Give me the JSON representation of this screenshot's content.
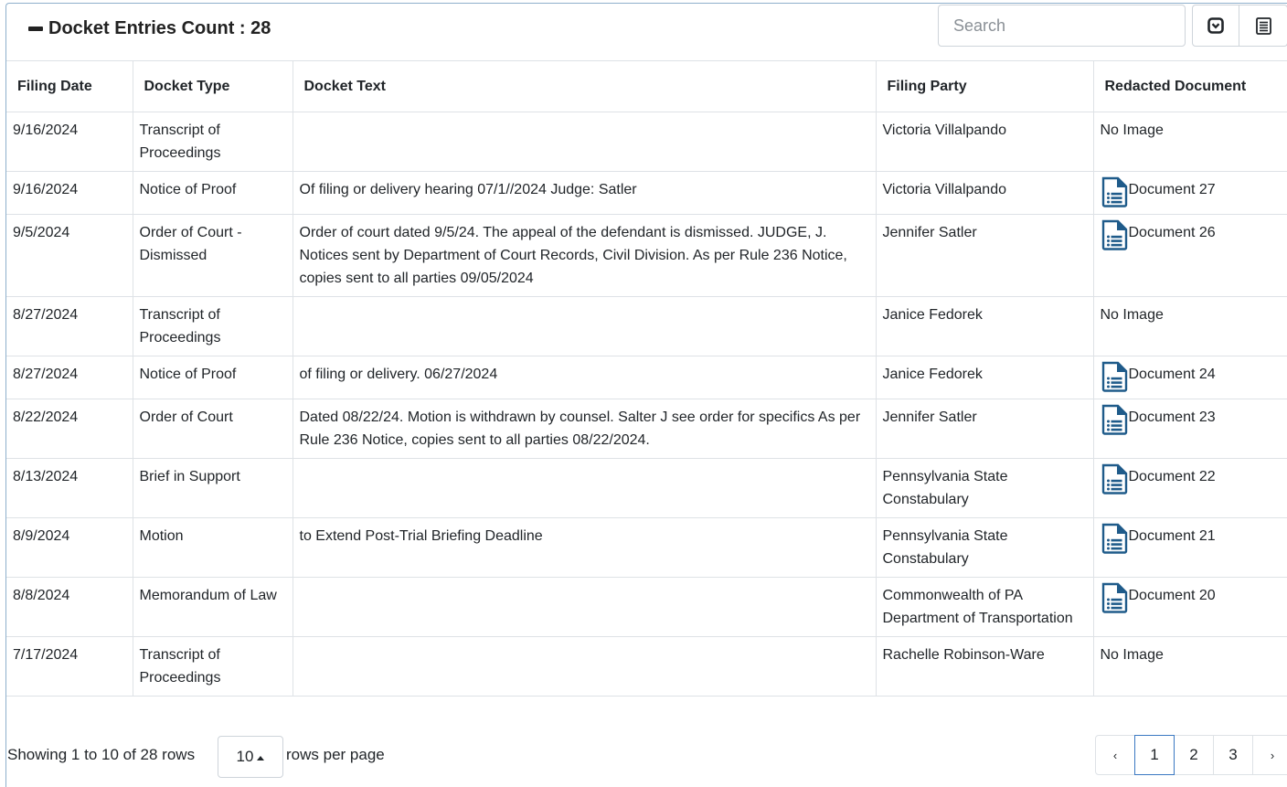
{
  "header": {
    "title": "Docket Entries Count : 28",
    "search_placeholder": "Search"
  },
  "table": {
    "columns": [
      "Filing Date",
      "Docket Type",
      "Docket Text",
      "Filing Party",
      "Redacted Document"
    ],
    "rows": [
      {
        "filing_date": "9/16/2024",
        "docket_type": "Transcript of Proceedings",
        "docket_text": "",
        "filing_party": "Victoria Villalpando",
        "document": "No Image",
        "has_doc": false
      },
      {
        "filing_date": "9/16/2024",
        "docket_type": "Notice of Proof",
        "docket_text": "Of filing or delivery hearing 07/1//2024 Judge: Satler",
        "filing_party": "Victoria Villalpando",
        "document": "Document 27",
        "has_doc": true
      },
      {
        "filing_date": "9/5/2024",
        "docket_type": "Order of Court - Dismissed",
        "docket_text": "Order of court dated 9/5/24. The appeal of the defendant is dismissed. JUDGE, J. Notices sent by Department of Court Records, Civil Division. As per Rule 236 Notice, copies sent to all parties 09/05/2024",
        "filing_party": "Jennifer Satler",
        "document": "Document 26",
        "has_doc": true
      },
      {
        "filing_date": "8/27/2024",
        "docket_type": "Transcript of Proceedings",
        "docket_text": "",
        "filing_party": "Janice Fedorek",
        "document": "No Image",
        "has_doc": false
      },
      {
        "filing_date": "8/27/2024",
        "docket_type": "Notice of Proof",
        "docket_text": "of filing or delivery. 06/27/2024",
        "filing_party": "Janice Fedorek",
        "document": "Document 24",
        "has_doc": true
      },
      {
        "filing_date": "8/22/2024",
        "docket_type": "Order of Court",
        "docket_text": "Dated 08/22/24. Motion is withdrawn by counsel. Salter J see order for specifics As per Rule 236 Notice, copies sent to all parties 08/22/2024.",
        "filing_party": "Jennifer Satler",
        "document": "Document 23",
        "has_doc": true
      },
      {
        "filing_date": "8/13/2024",
        "docket_type": "Brief in Support",
        "docket_text": "",
        "filing_party": "Pennsylvania State Constabulary",
        "document": "Document 22",
        "has_doc": true
      },
      {
        "filing_date": "8/9/2024",
        "docket_type": "Motion",
        "docket_text": "to Extend Post-Trial Briefing Deadline",
        "filing_party": "Pennsylvania State Constabulary",
        "document": "Document 21",
        "has_doc": true
      },
      {
        "filing_date": "8/8/2024",
        "docket_type": "Memorandum of Law",
        "docket_text": "",
        "filing_party": "Commonwealth of PA Department of Transportation",
        "document": "Document 20",
        "has_doc": true
      },
      {
        "filing_date": "7/17/2024",
        "docket_type": "Transcript of Proceedings",
        "docket_text": "",
        "filing_party": "Rachelle Robinson-Ware",
        "document": "No Image",
        "has_doc": false
      }
    ]
  },
  "footer": {
    "showing": "Showing 1 to 10 of 28 rows",
    "page_size": "10",
    "rows_per_page": "rows per page",
    "pages": [
      "1",
      "2",
      "3"
    ],
    "active_page": "1",
    "prev": "‹",
    "next": "›"
  },
  "colors": {
    "accent": "#3a78c2",
    "doc_icon": "#1f5b8a"
  }
}
